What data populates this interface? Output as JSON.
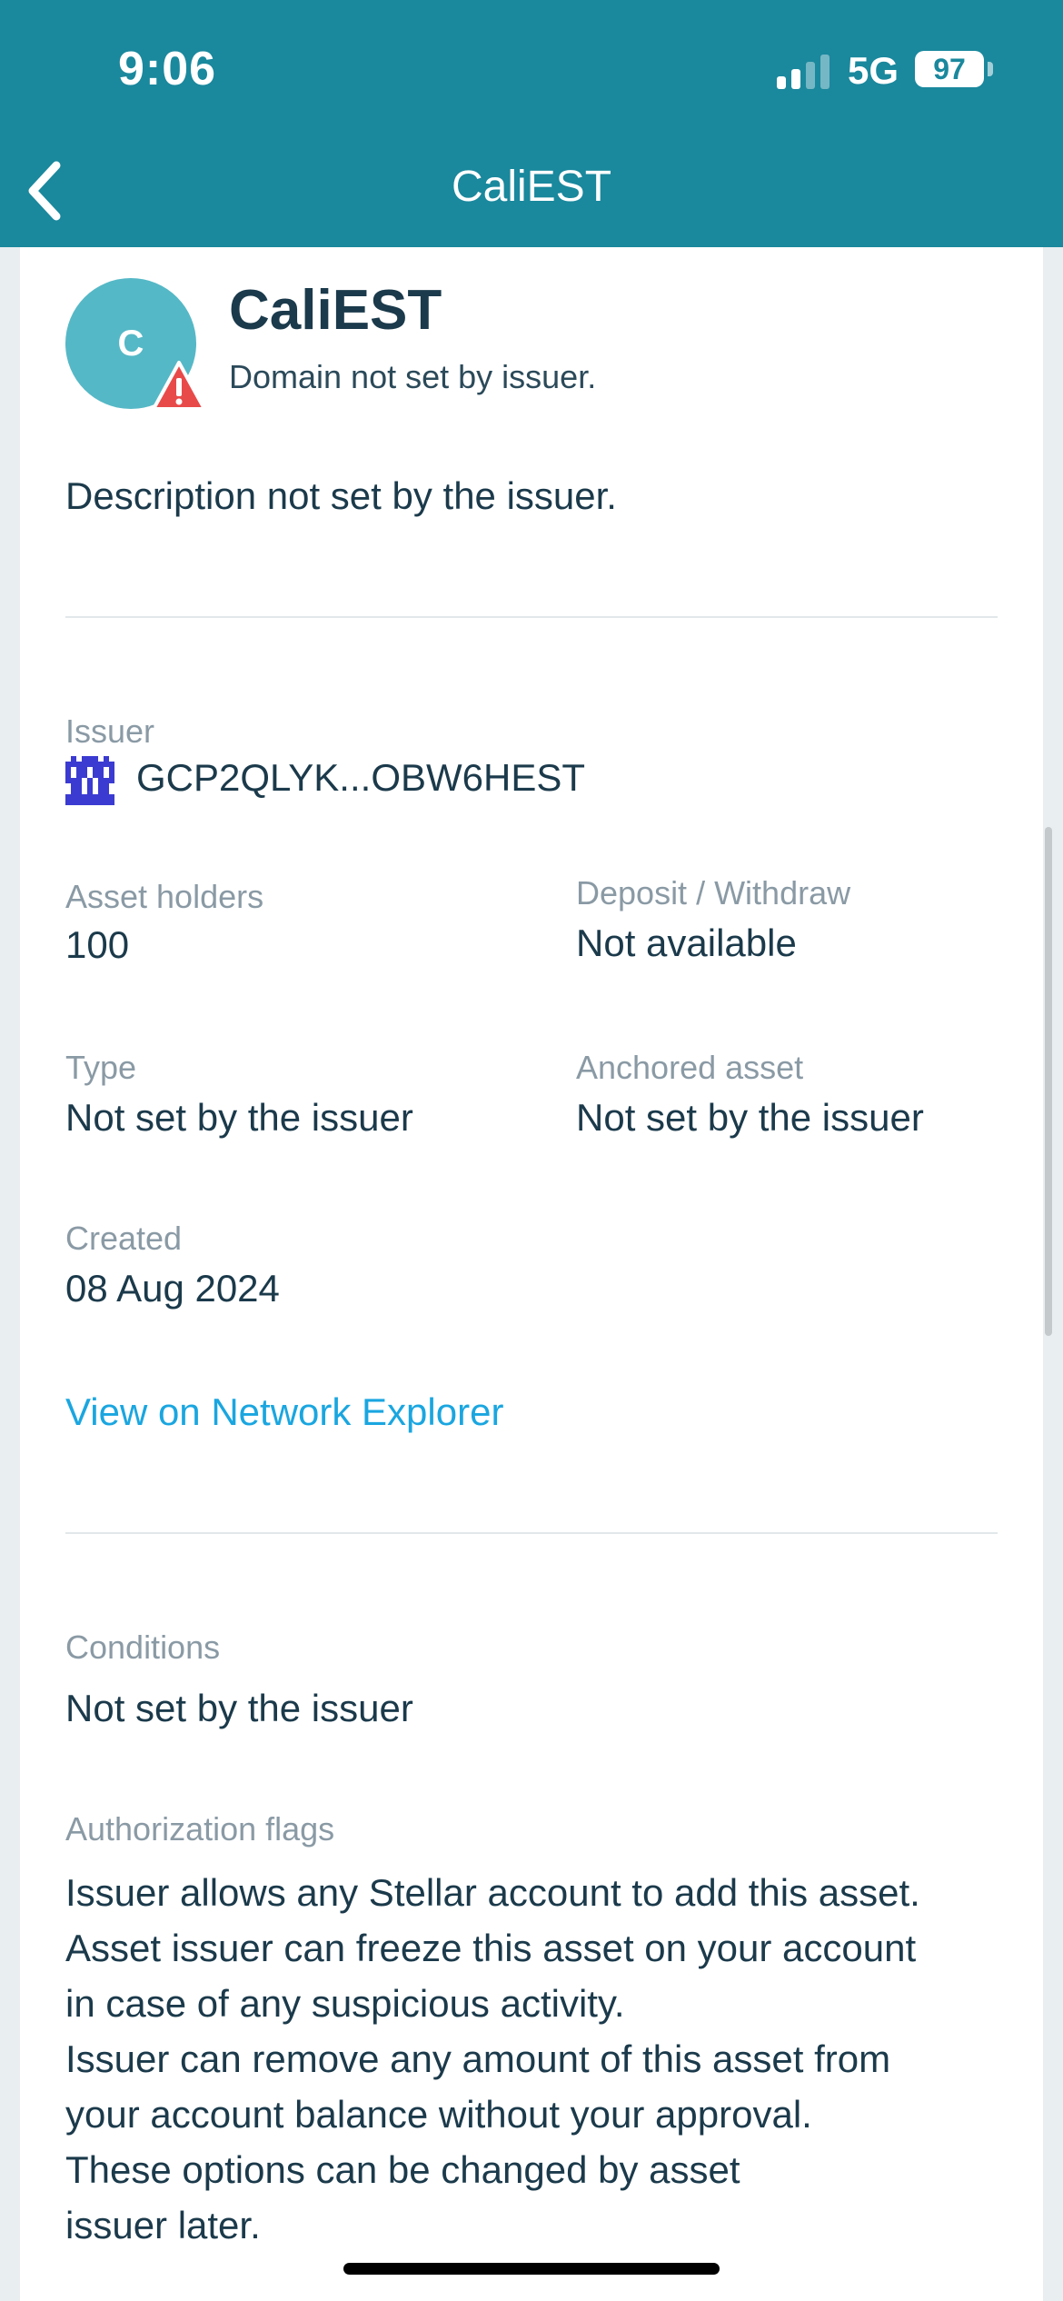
{
  "status_bar": {
    "time": "9:06",
    "network": "5G",
    "battery": "97"
  },
  "nav": {
    "title": "CaliEST"
  },
  "asset": {
    "avatar_letter": "C",
    "name": "CaliEST",
    "domain": "Domain not set by issuer.",
    "description": "Description not set by the issuer."
  },
  "issuer": {
    "label": "Issuer",
    "key": "GCP2QLYK...OBW6HEST"
  },
  "details": {
    "holders_label": "Asset holders",
    "holders_value": "100",
    "deposit_label": "Deposit / Withdraw",
    "deposit_value": "Not available",
    "type_label": "Type",
    "type_value": "Not set by the issuer",
    "anchored_label": "Anchored asset",
    "anchored_value": "Not set by the issuer",
    "created_label": "Created",
    "created_value": "08 Aug 2024"
  },
  "explorer_link": "View on Network Explorer",
  "conditions": {
    "label": "Conditions",
    "value": "Not set by the issuer"
  },
  "authorization": {
    "label": "Authorization flags",
    "lines": [
      "Issuer allows any Stellar account to add this asset.",
      "Asset issuer can freeze this asset on your account",
      "in case of any suspicious activity.",
      "Issuer can remove any amount of this asset from",
      "your account balance without your approval.",
      "These options can be changed by asset",
      "issuer later."
    ]
  },
  "colors": {
    "header": "#1a889d",
    "avatar": "#55b8c6",
    "link": "#1aa6e0",
    "warning": "#e84a4a",
    "identicon": "#3b3bd1"
  },
  "icons": [
    "back-chevron-icon",
    "signal-icon",
    "battery-icon",
    "warning-icon",
    "identicon-icon"
  ]
}
